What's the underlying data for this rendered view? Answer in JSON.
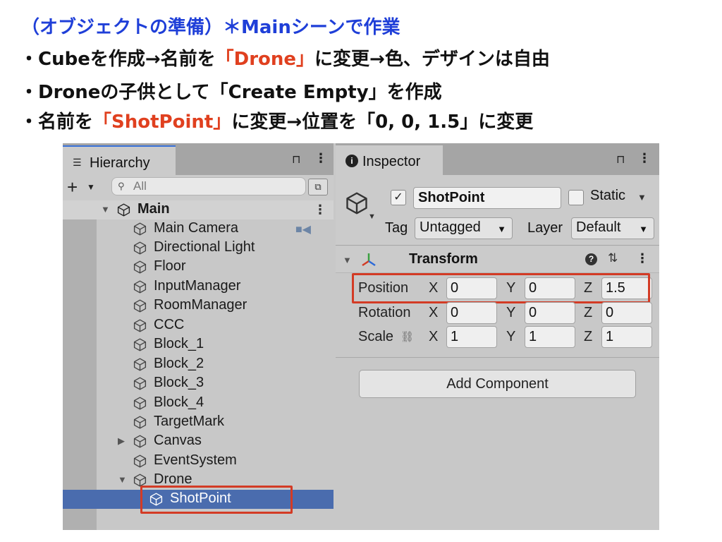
{
  "slide": {
    "title": "（オブジェクトの準備）＊Mainシーンで作業",
    "bullets": [
      {
        "pre": "・Cubeを作成→名前を",
        "hl": "「Drone」",
        "post": "に変更→色、デザインは自由"
      },
      {
        "pre": "・Droneの子供として「Create Empty」を作成",
        "hl": "",
        "post": ""
      },
      {
        "pre": "・名前を",
        "hl": "「ShotPoint」",
        "post": "に変更→位置を「0, 0, 1.5」に変更"
      }
    ],
    "accent_color": "#1f3fd8",
    "highlight_color": "#e0401f"
  },
  "hierarchy": {
    "tab_label": "Hierarchy",
    "search_placeholder": "All",
    "scene": "Main",
    "items": [
      "Main Camera",
      "Directional Light",
      "Floor",
      "InputManager",
      "RoomManager",
      "CCC",
      "Block_1",
      "Block_2",
      "Block_3",
      "Block_4",
      "TargetMark",
      "Canvas",
      "EventSystem",
      "Drone"
    ],
    "selected": "ShotPoint"
  },
  "inspector": {
    "tab_label": "Inspector",
    "object_name": "ShotPoint",
    "static_label": "Static",
    "tag_label": "Tag",
    "tag_value": "Untagged",
    "layer_label": "Layer",
    "layer_value": "Default",
    "component_title": "Transform",
    "rows": [
      {
        "label": "Position",
        "x": "0",
        "y": "0",
        "z": "1.5"
      },
      {
        "label": "Rotation",
        "x": "0",
        "y": "0",
        "z": "0"
      },
      {
        "label": "Scale",
        "x": "1",
        "y": "1",
        "z": "1"
      }
    ],
    "axis_x": "X",
    "axis_y": "Y",
    "axis_z": "Z",
    "add_component": "Add Component"
  },
  "colors": {
    "selection": "#4a6cae",
    "callout": "#d33b25"
  }
}
